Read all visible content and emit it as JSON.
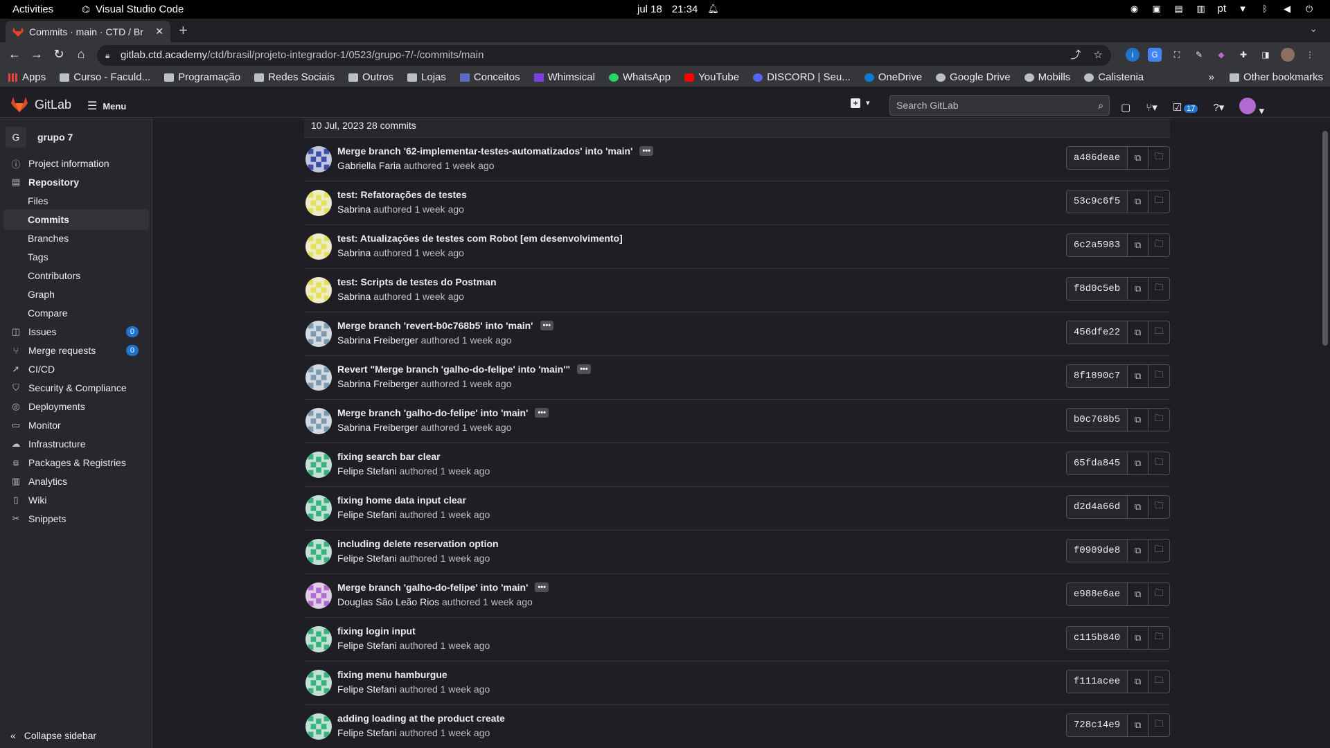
{
  "os": {
    "activities": "Activities",
    "app_name": "Visual Studio Code",
    "date": "jul 18",
    "time": "21:34",
    "lang": "pt"
  },
  "browser": {
    "tab_title": "Commits · main · CTD / Br",
    "url_host": "gitlab.ctd.academy",
    "url_path": "/ctd/brasil/projeto-integrador-1/0523/grupo-7/-/commits/main",
    "bookmarks": [
      {
        "label": "Apps",
        "icon": "apps-grid-icon"
      },
      {
        "label": "Curso - Faculd...",
        "icon": "folder-icon"
      },
      {
        "label": "Programação",
        "icon": "folder-icon"
      },
      {
        "label": "Redes Sociais",
        "icon": "folder-icon"
      },
      {
        "label": "Outros",
        "icon": "folder-icon"
      },
      {
        "label": "Lojas",
        "icon": "folder-icon"
      },
      {
        "label": "Conceitos",
        "icon": "monitor-icon"
      },
      {
        "label": "Whimsical",
        "icon": "whimsical-icon"
      },
      {
        "label": "WhatsApp",
        "icon": "whatsapp-icon"
      },
      {
        "label": "YouTube",
        "icon": "youtube-icon"
      },
      {
        "label": "DISCORD | Seu...",
        "icon": "discord-icon"
      },
      {
        "label": "OneDrive",
        "icon": "onedrive-icon"
      },
      {
        "label": "Google Drive",
        "icon": "globe-icon"
      },
      {
        "label": "Mobills",
        "icon": "globe-icon"
      },
      {
        "label": "Calistenia",
        "icon": "globe-icon"
      }
    ],
    "other_bookmarks": "Other bookmarks"
  },
  "gitlab": {
    "brand": "GitLab",
    "menu_label": "Menu",
    "search_placeholder": "Search GitLab",
    "todo_count": "17"
  },
  "sidebar": {
    "project_initial": "G",
    "project_name": "grupo 7",
    "items": [
      {
        "label": "Project information",
        "icon": "info-icon"
      },
      {
        "label": "Repository",
        "icon": "doc-icon"
      },
      {
        "label": "Files"
      },
      {
        "label": "Commits"
      },
      {
        "label": "Branches"
      },
      {
        "label": "Tags"
      },
      {
        "label": "Contributors"
      },
      {
        "label": "Graph"
      },
      {
        "label": "Compare"
      },
      {
        "label": "Issues",
        "icon": "issues-icon",
        "count": "0"
      },
      {
        "label": "Merge requests",
        "icon": "merge-request-icon",
        "count": "0"
      },
      {
        "label": "CI/CD",
        "icon": "rocket-icon"
      },
      {
        "label": "Security & Compliance",
        "icon": "shield-icon"
      },
      {
        "label": "Deployments",
        "icon": "deployments-icon"
      },
      {
        "label": "Monitor",
        "icon": "monitor-icon"
      },
      {
        "label": "Infrastructure",
        "icon": "cloud-icon"
      },
      {
        "label": "Packages & Registries",
        "icon": "package-icon"
      },
      {
        "label": "Analytics",
        "icon": "chart-icon"
      },
      {
        "label": "Wiki",
        "icon": "book-icon"
      },
      {
        "label": "Snippets",
        "icon": "scissors-icon"
      }
    ],
    "collapse_label": "Collapse sidebar"
  },
  "commits": {
    "day_header": "10 Jul, 2023 28 commits",
    "authored_word": "authored",
    "list": [
      {
        "title": "Merge branch '62-implementar-testes-automatizados' into 'main'",
        "author": "Gabriella Faria",
        "when": "1 week ago",
        "sha": "a486deae",
        "ellipsis": true,
        "avatar_color": "#3b4ea8"
      },
      {
        "title": "test: Refatorações de testes",
        "author": "Sabrina",
        "when": "1 week ago",
        "sha": "53c9c6f5",
        "ellipsis": false,
        "avatar_color": "#e5e05a"
      },
      {
        "title": "test: Atualizações de testes com Robot [em desenvolvimento]",
        "author": "Sabrina",
        "when": "1 week ago",
        "sha": "6c2a5983",
        "ellipsis": false,
        "avatar_color": "#e5e05a"
      },
      {
        "title": "test: Scripts de testes do Postman",
        "author": "Sabrina",
        "when": "1 week ago",
        "sha": "f8d0c5eb",
        "ellipsis": false,
        "avatar_color": "#e5e05a"
      },
      {
        "title": "Merge branch 'revert-b0c768b5' into 'main'",
        "author": "Sabrina Freiberger",
        "when": "1 week ago",
        "sha": "456dfe22",
        "ellipsis": true,
        "avatar_color": "#7a9bb0"
      },
      {
        "title": "Revert \"Merge branch 'galho-do-felipe' into 'main'\"",
        "author": "Sabrina Freiberger",
        "when": "1 week ago",
        "sha": "8f1890c7",
        "ellipsis": true,
        "avatar_color": "#7a9bb0"
      },
      {
        "title": "Merge branch 'galho-do-felipe' into 'main'",
        "author": "Sabrina Freiberger",
        "when": "1 week ago",
        "sha": "b0c768b5",
        "ellipsis": true,
        "avatar_color": "#7a9bb0"
      },
      {
        "title": "fixing search bar clear",
        "author": "Felipe Stefani",
        "when": "1 week ago",
        "sha": "65fda845",
        "ellipsis": false,
        "avatar_color": "#36b37e"
      },
      {
        "title": "fixing home data input clear",
        "author": "Felipe Stefani",
        "when": "1 week ago",
        "sha": "d2d4a66d",
        "ellipsis": false,
        "avatar_color": "#36b37e"
      },
      {
        "title": "including delete reservation option",
        "author": "Felipe Stefani",
        "when": "1 week ago",
        "sha": "f0909de8",
        "ellipsis": false,
        "avatar_color": "#36b37e"
      },
      {
        "title": "Merge branch 'galho-do-felipe' into 'main'",
        "author": "Douglas São Leão Rios",
        "when": "1 week ago",
        "sha": "e988e6ae",
        "ellipsis": true,
        "avatar_color": "#b26ad1"
      },
      {
        "title": "fixing login input",
        "author": "Felipe Stefani",
        "when": "1 week ago",
        "sha": "c115b840",
        "ellipsis": false,
        "avatar_color": "#36b37e"
      },
      {
        "title": "fixing menu hamburgue",
        "author": "Felipe Stefani",
        "when": "1 week ago",
        "sha": "f111acee",
        "ellipsis": false,
        "avatar_color": "#36b37e"
      },
      {
        "title": "adding loading at the product create",
        "author": "Felipe Stefani",
        "when": "1 week ago",
        "sha": "728c14e9",
        "ellipsis": false,
        "avatar_color": "#36b37e"
      }
    ]
  }
}
